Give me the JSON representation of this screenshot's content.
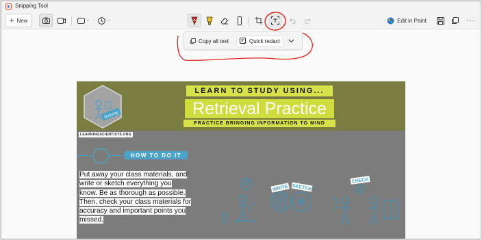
{
  "app": {
    "title": "Snipping Tool"
  },
  "toolbar": {
    "new_label": "New",
    "edit_in_paint_label": "Edit in Paint",
    "icons": [
      "camera-icon",
      "video-icon",
      "rectangle-mode-icon",
      "timer-icon",
      "red-pen-icon",
      "highlighter-icon",
      "eraser-icon",
      "ruler-icon",
      "crop-icon",
      "text-actions-icon",
      "undo-icon",
      "redo-icon",
      "paint-icon",
      "save-icon",
      "copy-icon",
      "more-icon"
    ]
  },
  "text_actions": {
    "copy_all_label": "Copy all text",
    "quick_redact_label": "Quick redact"
  },
  "colors": {
    "annotation_red": "#e2231a",
    "banner_olive": "#7b7c40",
    "highlight_yellow": "#d7e14a",
    "accent_blue": "#4aa3c8"
  },
  "capture": {
    "logo_badge": "Quizzing",
    "site": "LEARNINGSCIENTISTS.ORG",
    "heading_1": "LEARN TO STUDY USING...",
    "heading_2": "Retrieval Practice",
    "heading_3": "PRACTICE BRINGING INFORMATION TO MIND",
    "section_title": "HOW TO DO IT",
    "paragraph_lines": [
      "Put away your class materials, and",
      "write or sketch everything you",
      "know. Be as thorough as possible.",
      "Then, check your class materials for",
      "accuracy and important points you",
      "missed."
    ],
    "tags": {
      "write": "WRITE",
      "sketch": "SKETCH",
      "check": "CHECK"
    }
  }
}
